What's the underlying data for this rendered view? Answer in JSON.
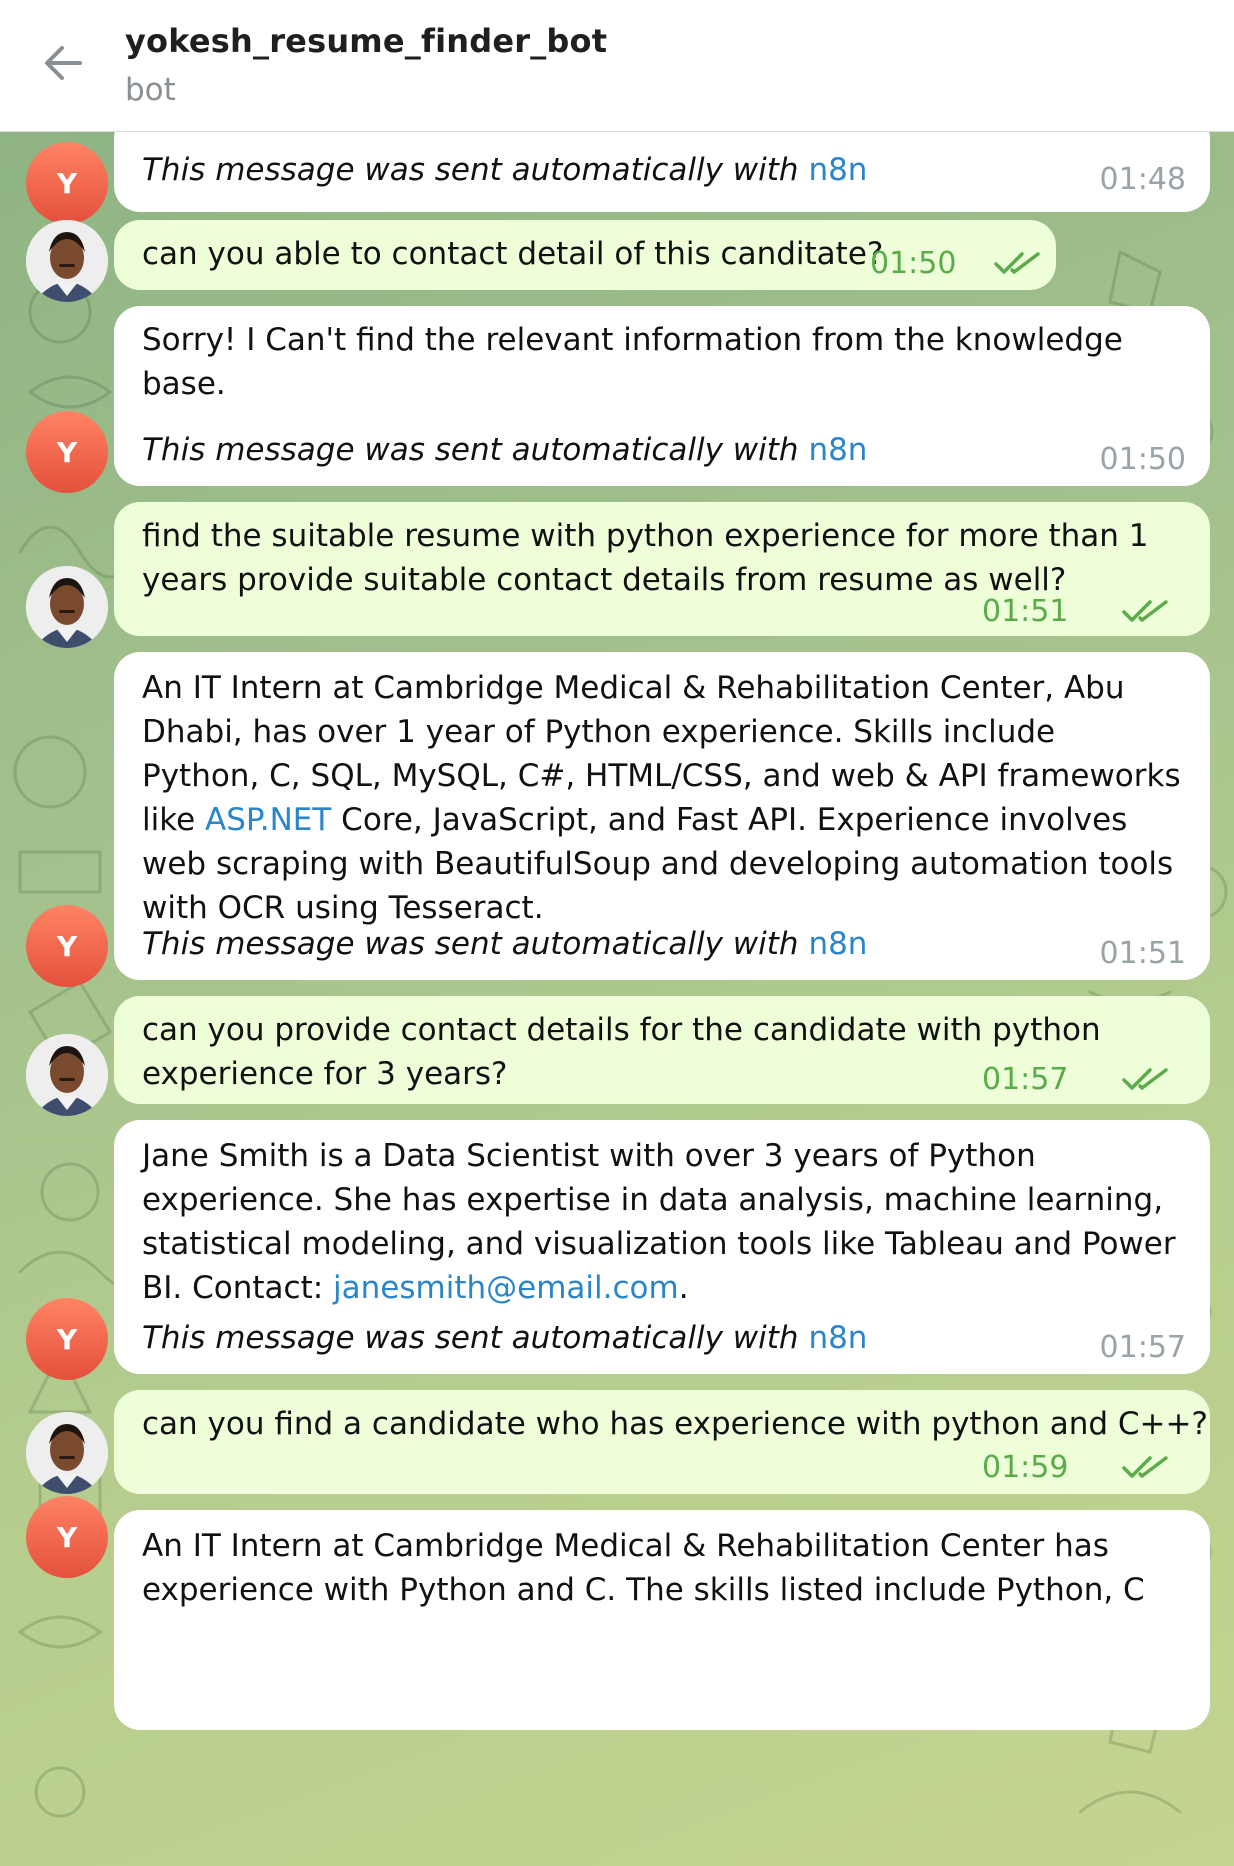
{
  "header": {
    "title": "yokesh_resume_finder_bot",
    "subtitle": "bot"
  },
  "bot_avatar_letter": "Y",
  "auto_footer": {
    "prefix": "This message was sent automatically with ",
    "link": "n8n"
  },
  "messages": [
    {
      "role": "bot",
      "time": "01:48"
    },
    {
      "role": "user",
      "text": "can you able to contact detail of this canditate?",
      "time": "01:50",
      "status": "read"
    },
    {
      "role": "bot",
      "text": "Sorry! I Can't find the relevant information from the knowledge base.",
      "time": "01:50"
    },
    {
      "role": "user",
      "text": "find the suitable resume with python experience for more than 1 years provide suitable contact details from resume as well?",
      "time": "01:51",
      "status": "read"
    },
    {
      "role": "bot",
      "text_before": "An IT Intern at Cambridge Medical & Rehabilitation Center, Abu Dhabi, has over 1 year of Python experience. Skills include Python, C, SQL, MySQL, C#, HTML/CSS, and web & API frameworks like ",
      "link": "ASP.NET",
      "text_after": " Core, JavaScript, and Fast API. Experience involves web scraping with BeautifulSoup and developing automation tools with OCR using Tesseract.",
      "time": "01:51"
    },
    {
      "role": "user",
      "text": "can you provide contact details for the candidate with python experience for 3 years?",
      "time": "01:57",
      "status": "read"
    },
    {
      "role": "bot",
      "text_before": "Jane Smith is a Data Scientist with over 3 years of Python experience. She has expertise in data analysis, machine learning, statistical modeling, and visualization tools like Tableau and Power BI. Contact: ",
      "link": "janesmith@email.com",
      "text_after": ".",
      "time": "01:57"
    },
    {
      "role": "user",
      "text": "can you find a candidate who has experience with python and C++?",
      "time": "01:59",
      "status": "read"
    },
    {
      "role": "bot",
      "text": "An IT Intern at Cambridge Medical & Rehabilitation Center has experience with Python and C. The skills listed include Python, C"
    }
  ],
  "colors": {
    "header_bg": "#ffffff",
    "incoming_bubble": "#ffffff",
    "outgoing_bubble": "#eefed9",
    "link": "#2a86c8",
    "outgoing_time": "#5bab4a",
    "incoming_time": "#9aa3a8",
    "bot_avatar": "#e4503c",
    "chat_bg": "#a3c18d"
  }
}
